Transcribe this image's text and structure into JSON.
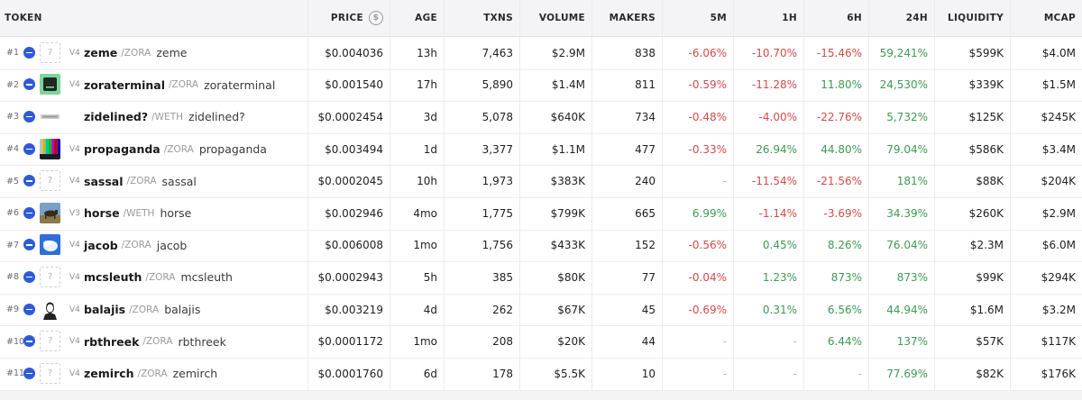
{
  "header": {
    "token": "TOKEN",
    "price": "PRICE",
    "price_icon": "coin-icon",
    "age": "AGE",
    "txns": "TXNS",
    "volume": "VOLUME",
    "makers": "MAKERS",
    "m5": "5M",
    "h1": "1H",
    "h6": "6H",
    "h24": "24H",
    "liquidity": "LIQUIDITY",
    "mcap": "MCAP"
  },
  "colors": {
    "negative": "#d24b4b",
    "positive": "#3f9a54",
    "chain_badge": "#2d5bd8"
  },
  "rows": [
    {
      "rank": "#1",
      "ver": "V4",
      "sym": "zeme",
      "pair": "/ZORA",
      "name": "zeme",
      "price": "$0.004036",
      "age": "13h",
      "txns": "7,463",
      "volume": "$2.9M",
      "makers": "838",
      "m5": "-6.06%",
      "h1": "-10.70%",
      "h6": "-15.46%",
      "h24": "59,241%",
      "liquidity": "$599K",
      "mcap": "$4.0M",
      "thumb": "placeholder"
    },
    {
      "rank": "#2",
      "ver": "V4",
      "sym": "zoraterminal",
      "pair": "/ZORA",
      "name": "zoraterminal",
      "price": "$0.001540",
      "age": "17h",
      "txns": "5,890",
      "volume": "$1.4M",
      "makers": "811",
      "m5": "-0.59%",
      "h1": "-11.28%",
      "h6": "11.80%",
      "h24": "24,530%",
      "liquidity": "$339K",
      "mcap": "$1.5M",
      "thumb": "terminal"
    },
    {
      "rank": "#3",
      "ver": "",
      "sym": "zidelined?",
      "pair": "/WETH",
      "name": "zidelined?",
      "price": "$0.0002454",
      "age": "3d",
      "txns": "5,078",
      "volume": "$640K",
      "makers": "734",
      "m5": "-0.48%",
      "h1": "-4.00%",
      "h6": "-22.76%",
      "h24": "5,732%",
      "liquidity": "$125K",
      "mcap": "$245K",
      "thumb": "banner"
    },
    {
      "rank": "#4",
      "ver": "V4",
      "sym": "propaganda",
      "pair": "/ZORA",
      "name": "propaganda",
      "price": "$0.003494",
      "age": "1d",
      "txns": "3,377",
      "volume": "$1.1M",
      "makers": "477",
      "m5": "-0.33%",
      "h1": "26.94%",
      "h6": "44.80%",
      "h24": "79.04%",
      "liquidity": "$586K",
      "mcap": "$3.4M",
      "thumb": "colorbars"
    },
    {
      "rank": "#5",
      "ver": "V4",
      "sym": "sassal",
      "pair": "/ZORA",
      "name": "sassal",
      "price": "$0.0002045",
      "age": "10h",
      "txns": "1,973",
      "volume": "$383K",
      "makers": "240",
      "m5": "-",
      "h1": "-11.54%",
      "h6": "-21.56%",
      "h24": "181%",
      "liquidity": "$88K",
      "mcap": "$204K",
      "thumb": "placeholder"
    },
    {
      "rank": "#6",
      "ver": "V3",
      "sym": "horse",
      "pair": "/WETH",
      "name": "horse",
      "price": "$0.002946",
      "age": "4mo",
      "txns": "1,775",
      "volume": "$799K",
      "makers": "665",
      "m5": "6.99%",
      "h1": "-1.14%",
      "h6": "-3.69%",
      "h24": "34.39%",
      "liquidity": "$260K",
      "mcap": "$2.9M",
      "thumb": "horse"
    },
    {
      "rank": "#7",
      "ver": "V4",
      "sym": "jacob",
      "pair": "/ZORA",
      "name": "jacob",
      "price": "$0.006008",
      "age": "1mo",
      "txns": "1,756",
      "volume": "$433K",
      "makers": "152",
      "m5": "-0.56%",
      "h1": "0.45%",
      "h6": "8.26%",
      "h24": "76.04%",
      "liquidity": "$2.3M",
      "mcap": "$6.0M",
      "thumb": "sky"
    },
    {
      "rank": "#8",
      "ver": "V4",
      "sym": "mcsleuth",
      "pair": "/ZORA",
      "name": "mcsleuth",
      "price": "$0.0002943",
      "age": "5h",
      "txns": "385",
      "volume": "$80K",
      "makers": "77",
      "m5": "-0.04%",
      "h1": "1.23%",
      "h6": "873%",
      "h24": "873%",
      "liquidity": "$99K",
      "mcap": "$294K",
      "thumb": "placeholder"
    },
    {
      "rank": "#9",
      "ver": "V4",
      "sym": "balajis",
      "pair": "/ZORA",
      "name": "balajis",
      "price": "$0.003219",
      "age": "4d",
      "txns": "262",
      "volume": "$67K",
      "makers": "45",
      "m5": "-0.69%",
      "h1": "0.31%",
      "h6": "6.56%",
      "h24": "44.94%",
      "liquidity": "$1.6M",
      "mcap": "$3.2M",
      "thumb": "portrait"
    },
    {
      "rank": "#10",
      "ver": "V4",
      "sym": "rbthreek",
      "pair": "/ZORA",
      "name": "rbthreek",
      "price": "$0.0001172",
      "age": "1mo",
      "txns": "208",
      "volume": "$20K",
      "makers": "44",
      "m5": "-",
      "h1": "-",
      "h6": "6.44%",
      "h24": "137%",
      "liquidity": "$57K",
      "mcap": "$117K",
      "thumb": "placeholder"
    },
    {
      "rank": "#11",
      "ver": "V4",
      "sym": "zemirch",
      "pair": "/ZORA",
      "name": "zemirch",
      "price": "$0.0001760",
      "age": "6d",
      "txns": "178",
      "volume": "$5.5K",
      "makers": "10",
      "m5": "-",
      "h1": "-",
      "h6": "-",
      "h24": "77.69%",
      "liquidity": "$82K",
      "mcap": "$176K",
      "thumb": "placeholder"
    }
  ]
}
